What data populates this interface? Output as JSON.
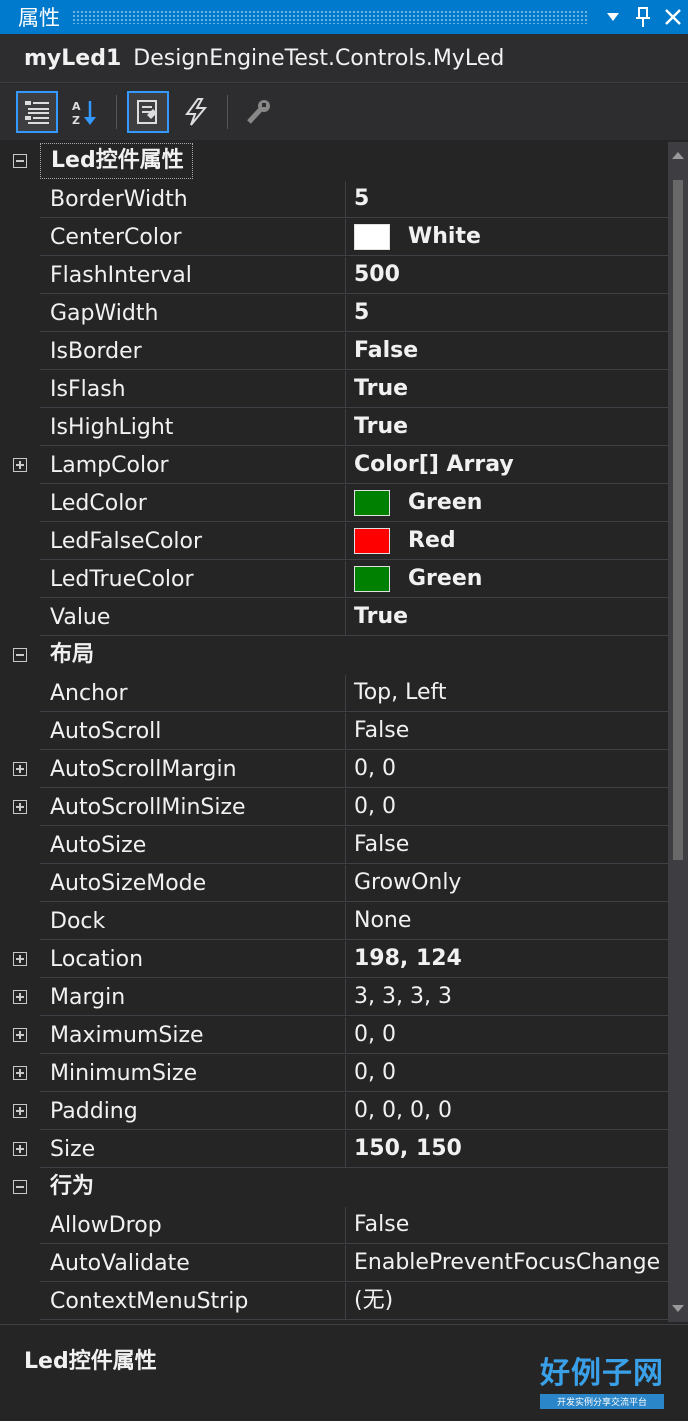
{
  "panel": {
    "title": "属性",
    "dropdown_icon": "triangle-down-icon",
    "pin_icon": "pin-icon",
    "close_icon": "close-icon"
  },
  "object_selector": {
    "name": "myLed1",
    "type": "DesignEngineTest.Controls.MyLed"
  },
  "toolbar": {
    "buttons": [
      {
        "icon": "categorized-icon",
        "active": true
      },
      {
        "icon": "alphabetical-icon",
        "active": false
      },
      {
        "icon": "properties-icon",
        "active": true
      },
      {
        "icon": "events-icon",
        "active": false
      },
      {
        "icon": "property-pages-icon",
        "active": false
      }
    ]
  },
  "categories": [
    {
      "label": "Led控件属性",
      "expanded": true,
      "properties": [
        {
          "name": "BorderWidth",
          "value": "5",
          "bold": true
        },
        {
          "name": "CenterColor",
          "value": "White",
          "bold": true,
          "swatch": "#ffffff"
        },
        {
          "name": "FlashInterval",
          "value": "500",
          "bold": true
        },
        {
          "name": "GapWidth",
          "value": "5",
          "bold": true
        },
        {
          "name": "IsBorder",
          "value": "False",
          "bold": true
        },
        {
          "name": "IsFlash",
          "value": "True",
          "bold": true
        },
        {
          "name": "IsHighLight",
          "value": "True",
          "bold": true
        },
        {
          "name": "LampColor",
          "value": "Color[] Array",
          "bold": true,
          "expandable": true
        },
        {
          "name": "LedColor",
          "value": "Green",
          "bold": true,
          "swatch": "#008000"
        },
        {
          "name": "LedFalseColor",
          "value": "Red",
          "bold": true,
          "swatch": "#ff0000"
        },
        {
          "name": "LedTrueColor",
          "value": "Green",
          "bold": true,
          "swatch": "#008000"
        },
        {
          "name": "Value",
          "value": "True",
          "bold": true
        }
      ]
    },
    {
      "label": "布局",
      "expanded": true,
      "properties": [
        {
          "name": "Anchor",
          "value": "Top, Left"
        },
        {
          "name": "AutoScroll",
          "value": "False"
        },
        {
          "name": "AutoScrollMargin",
          "value": "0, 0",
          "expandable": true
        },
        {
          "name": "AutoScrollMinSize",
          "value": "0, 0",
          "expandable": true
        },
        {
          "name": "AutoSize",
          "value": "False"
        },
        {
          "name": "AutoSizeMode",
          "value": "GrowOnly"
        },
        {
          "name": "Dock",
          "value": "None"
        },
        {
          "name": "Location",
          "value": "198, 124",
          "bold": true,
          "expandable": true
        },
        {
          "name": "Margin",
          "value": "3, 3, 3, 3",
          "expandable": true
        },
        {
          "name": "MaximumSize",
          "value": "0, 0",
          "expandable": true
        },
        {
          "name": "MinimumSize",
          "value": "0, 0",
          "expandable": true
        },
        {
          "name": "Padding",
          "value": "0, 0, 0, 0",
          "expandable": true
        },
        {
          "name": "Size",
          "value": "150, 150",
          "bold": true,
          "expandable": true
        }
      ]
    },
    {
      "label": "行为",
      "expanded": true,
      "properties": [
        {
          "name": "AllowDrop",
          "value": "False"
        },
        {
          "name": "AutoValidate",
          "value": "EnablePreventFocusChange"
        },
        {
          "name": "ContextMenuStrip",
          "value": "(无)"
        }
      ]
    }
  ],
  "description": {
    "title": "Led控件属性"
  },
  "watermark": {
    "main": "好例子网",
    "sub": "开发实例分享交流平台"
  },
  "colors": {
    "accent": "#007acc",
    "background": "#252526",
    "selection": "#3399ff"
  }
}
